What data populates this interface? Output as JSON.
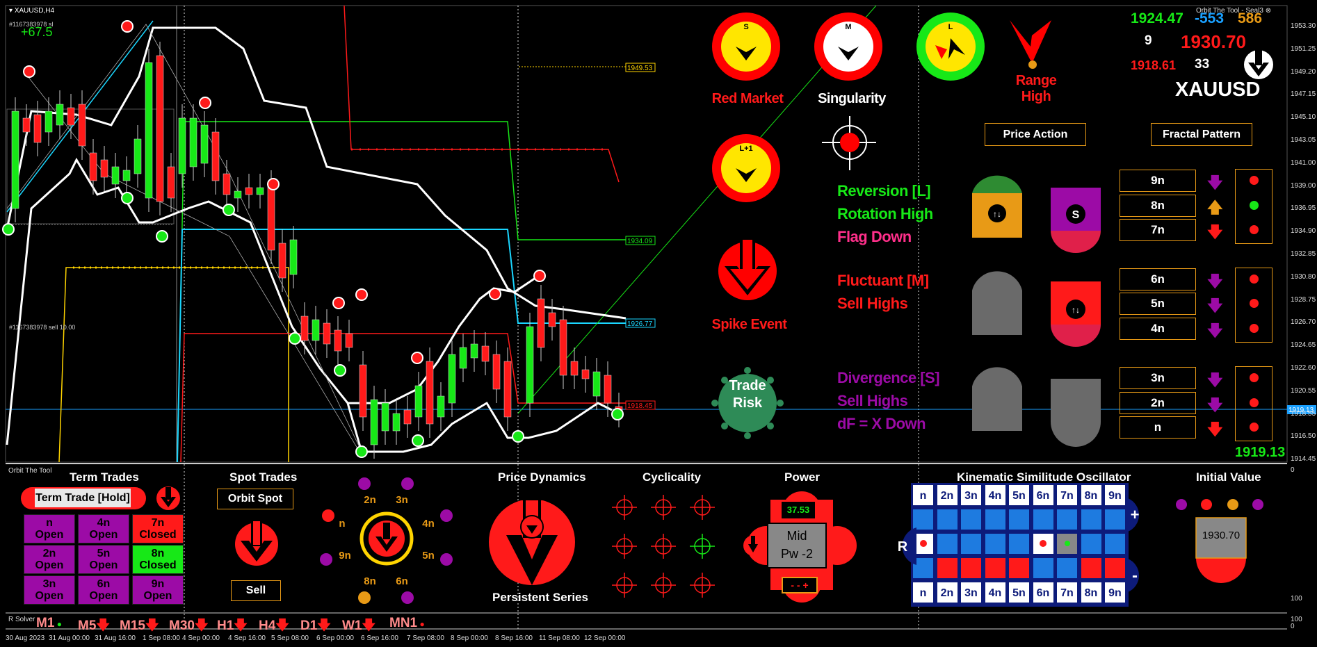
{
  "window": {
    "title": "XAUUSD,H4",
    "order_label": "#1167383978 sl",
    "order_label_2": "#1167383978 sell 10.00",
    "profit": "+67.5",
    "tool_name": "Orbit The Tool - Seal3",
    "panel_name": "Orbit The Tool",
    "solver_name": "R Solver"
  },
  "price_axis": [
    "1953.30",
    "1951.25",
    "1949.20",
    "1947.15",
    "1945.10",
    "1943.05",
    "1941.00",
    "1939.00",
    "1936.95",
    "1934.90",
    "1932.85",
    "1930.80",
    "1928.75",
    "1926.70",
    "1924.65",
    "1922.60",
    "1920.55",
    "1918.55",
    "1916.50",
    "1914.45"
  ],
  "current_price_tag": "1919.13",
  "oscillator_axis": [
    "0",
    "100",
    "100",
    "0"
  ],
  "date_axis": [
    "30 Aug 2023",
    "31 Aug 00:00",
    "31 Aug 16:00",
    "1 Sep 08:00",
    "4 Sep 00:00",
    "4 Sep 16:00",
    "5 Sep 08:00",
    "6 Sep 00:00",
    "6 Sep 16:00",
    "7 Sep 08:00",
    "8 Sep 00:00",
    "8 Sep 16:00",
    "11 Sep 08:00",
    "12 Sep 00:00"
  ],
  "level_tags": {
    "l1": "1949.53",
    "l2": "1934.09",
    "l3": "1926.77",
    "l4": "1918.45"
  },
  "signals": {
    "s_label": "S",
    "m_label": "M",
    "l_label": "L",
    "l1_label": "L+1",
    "red_market": "Red Market",
    "singularity": "Singularity",
    "range_high": "Range High",
    "spike_event": "Spike Event",
    "trade_risk": "Trade Risk"
  },
  "status_lines": {
    "group1": [
      "Reversion [L]",
      "Rotation High",
      "Flag Down"
    ],
    "group2": [
      "Fluctuant [M]",
      "Sell Highs"
    ],
    "group3": [
      "Divergence [S]",
      "Sell Highs",
      "dF = X Down"
    ]
  },
  "quote_panel": {
    "price_green": "1924.47",
    "value_blue": "-553",
    "value_orange": "586",
    "count_white": "9",
    "price_red_big": "1930.70",
    "price_red_small": "1918.61",
    "count_33": "33",
    "symbol": "XAUUSD",
    "price_bottom": "1919.13"
  },
  "buttons": {
    "price_action": "Price Action",
    "fractal_pattern": "Fractal Pattern",
    "term_trade": "Term Trade [Hold]",
    "orbit_spot": "Orbit Spot",
    "sell": "Sell"
  },
  "levels": [
    "9n",
    "8n",
    "7n",
    "6n",
    "5n",
    "4n",
    "3n",
    "2n",
    "n"
  ],
  "panels": {
    "term_trades": "Term Trades",
    "spot_trades": "Spot Trades",
    "price_dynamics": "Price Dynamics",
    "persistent_series": "Persistent Series",
    "cyclicality": "Cyclicality",
    "power": "Power",
    "kso": "Kinematic Similitude Oscillator",
    "initial_value": "Initial Value"
  },
  "term_grid": [
    {
      "n": "n",
      "s": "Open",
      "c": "#9c0ba6"
    },
    {
      "n": "4n",
      "s": "Open",
      "c": "#9c0ba6"
    },
    {
      "n": "7n",
      "s": "Closed",
      "c": "#ff1a1a"
    },
    {
      "n": "2n",
      "s": "Open",
      "c": "#9c0ba6"
    },
    {
      "n": "5n",
      "s": "Open",
      "c": "#9c0ba6"
    },
    {
      "n": "8n",
      "s": "Closed",
      "c": "#17e817"
    },
    {
      "n": "3n",
      "s": "Open",
      "c": "#9c0ba6"
    },
    {
      "n": "6n",
      "s": "Open",
      "c": "#9c0ba6"
    },
    {
      "n": "9n",
      "s": "Open",
      "c": "#9c0ba6"
    }
  ],
  "orbit_labels": [
    "2n",
    "3n",
    "4n",
    "5n",
    "6n",
    "8n",
    "9n",
    "n"
  ],
  "power": {
    "value": "37.53",
    "mode": "Mid",
    "pw": "Pw -2",
    "controls": "- - +"
  },
  "kso_headers": [
    "n",
    "2n",
    "3n",
    "4n",
    "5n",
    "6n",
    "7n",
    "8n",
    "9n"
  ],
  "kso_side": {
    "r": "R",
    "plus": "+",
    "minus": "-"
  },
  "initial_value": "1930.70",
  "timeframes": [
    "M1",
    "M5",
    "M15",
    "M30",
    "H1",
    "H4",
    "D1",
    "W1",
    "MN1"
  ],
  "colors": {
    "red": "#ff0000",
    "green": "#17e817",
    "yellow": "#ffe600",
    "purple": "#9c0ba6",
    "orange": "#e89a16",
    "cyan": "#1ad6ff",
    "bg": "#000000"
  }
}
